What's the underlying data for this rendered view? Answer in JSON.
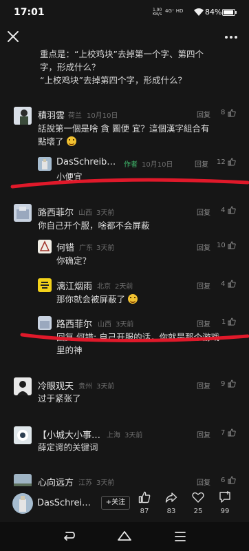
{
  "status": {
    "time": "17:01",
    "net_rate_1": "1.90",
    "net_rate_2": "KB/s",
    "signal": "4G⁺ HD",
    "battery": "84%"
  },
  "post": {
    "line1": "重点是：“上校鸡块”去掉第一个字、第四个",
    "line2": "字，形成什么？",
    "line3": "“上校鸡块”去掉第四个字，形成什么？"
  },
  "comments": [
    {
      "name": "積羽雲",
      "location": "荷兰",
      "time": "10月10日",
      "text_line1": "話說第一個是啥 貪 圖便 宜？這個漢字組合有",
      "text_line2": "點壞了",
      "reply_label": "回复",
      "likes": "8",
      "replies": [
        {
          "name": "DasSchreib…",
          "tag": "作者",
          "time": "10月10日",
          "text": "小便宜",
          "reply_label": "回复",
          "likes": "12"
        }
      ]
    },
    {
      "name": "路西菲尔",
      "location": "山西",
      "time": "3天前",
      "text_line1": "你自己开个服，啥都不会屏蔽",
      "reply_label": "回复",
      "likes": "4",
      "replies": [
        {
          "name": "何错",
          "location": "广东",
          "time": "3天前",
          "text": "你确定？",
          "reply_label": "回复",
          "likes": "10"
        },
        {
          "name": "漓江烟雨",
          "location": "北京",
          "time": "2天前",
          "text": "那你就会被屏蔽了",
          "reply_label": "回复",
          "likes": "4"
        },
        {
          "name": "路西菲尔",
          "location": "山西",
          "time": "3天前",
          "text_line1": "回复 何错: 自己开服的话，你就是那个游戏",
          "text_line2": "里的神",
          "reply_label": "回复",
          "likes": "1"
        }
      ]
    },
    {
      "name": "冷眼观天",
      "location": "贵州",
      "time": "3天前",
      "text_line1": "过于紧张了",
      "reply_label": "回复",
      "likes": "9"
    },
    {
      "name": "【小城大小事…",
      "location": "上海",
      "time": "3天前",
      "text_line1": "薛定谔的关键词",
      "reply_label": "回复",
      "likes": "7"
    },
    {
      "name": "心向远方",
      "location": "江苏",
      "time": "3天前",
      "reply_label": "回复",
      "likes": "6"
    }
  ],
  "bottom": {
    "author": "DasSchrei…",
    "follow_label": "+关注",
    "likes": "87",
    "shares": "83",
    "favorites": "25",
    "comments": "99"
  },
  "annotation_color": "#e0192a"
}
